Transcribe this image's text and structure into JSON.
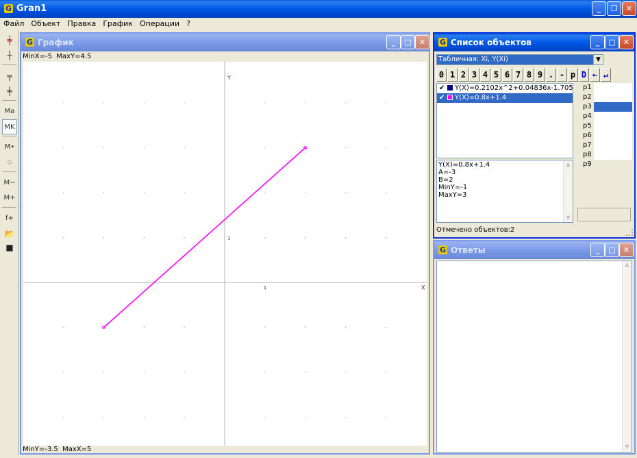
{
  "app": {
    "title": "Gran1"
  },
  "menu": [
    "Файл",
    "Объект",
    "Правка",
    "График",
    "Операции",
    "?"
  ],
  "toolbar": [
    "axes-red-icon",
    "axes-icon",
    "axes-corner-icon",
    "axes-cross-icon",
    "Ma",
    "MK",
    "M•",
    "points-icon",
    "M−",
    "M+",
    "f+",
    "open-folder-icon",
    "save-icon"
  ],
  "graph": {
    "title": "График",
    "top_status": "MinX=-5  MaxY=4.5",
    "bottom_status": "MinY=-3.5  MaxX=5",
    "axis_x_label": "X",
    "axis_y_label": "Y",
    "tick_x": "1",
    "tick_y": "1",
    "line_color": "#ff00ff",
    "line_start": [
      -3,
      -1
    ],
    "line_end": [
      2,
      3
    ]
  },
  "objects": {
    "title": "Список объектов",
    "dropdown": "Табличная: Xi, Y(Xi)",
    "keypad": [
      "0",
      "1",
      "2",
      "3",
      "4",
      "5",
      "6",
      "7",
      "8",
      "9",
      ".",
      "-",
      "p",
      "D"
    ],
    "items": [
      {
        "text": "Y(X)=0.2102x^2+0.04836x-1.705",
        "color": "#000080",
        "checked": "✔"
      },
      {
        "text": "Y(X)=0.8x+1.4",
        "color": "#ff00ff",
        "checked": "✔"
      }
    ],
    "params": [
      "p1",
      "p2",
      "p3",
      "p4",
      "p5",
      "p6",
      "p7",
      "p8",
      "p9"
    ],
    "details": [
      "Y(X)=0.8x+1.4",
      "A=-3",
      "B=2",
      "MinY=-1",
      "MaxY=3"
    ],
    "status": "Отмечено объектов:2"
  },
  "answers": {
    "title": "Ответы"
  }
}
